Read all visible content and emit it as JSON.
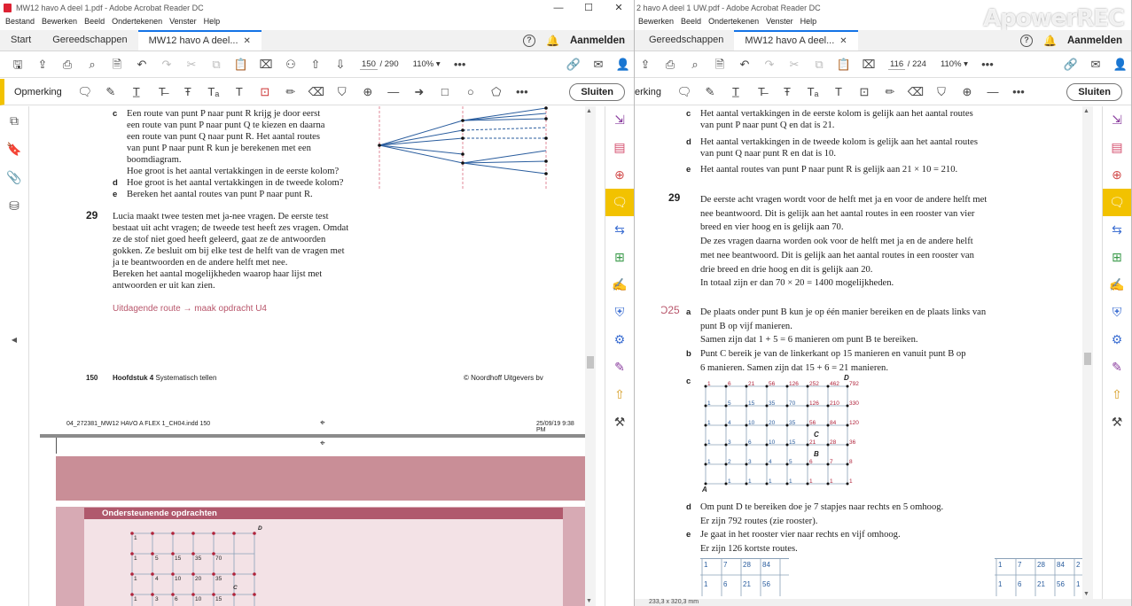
{
  "left": {
    "title": "MW12 havo A deel 1.pdf - Adobe Acrobat Reader DC",
    "menu": [
      "Bestand",
      "Bewerken",
      "Beeld",
      "Ondertekenen",
      "Venster",
      "Help"
    ],
    "tabs": {
      "start": "Start",
      "tools": "Gereedschappen",
      "doc": "MW12 havo A deel..."
    },
    "login": "Aanmelden",
    "page_current": "150",
    "page_total": "/ 290",
    "zoom": "110%",
    "comment_title": "Opmerking",
    "close_label": "Sluiten",
    "page": {
      "q_c_label": "c",
      "q_c_lines": [
        "Een route van punt P naar punt R krijg je door eerst",
        "een route van punt P naar punt Q te kiezen en daarna",
        "een route van punt Q naar punt R. Het aantal routes",
        "van punt P naar punt R kun je berekenen met een",
        "boomdiagram.",
        "Hoe groot is het aantal vertakkingen in de eerste kolom?"
      ],
      "q_d_label": "d",
      "q_d": "Hoe groot is het aantal vertakkingen in de tweede kolom?",
      "q_e_label": "e",
      "q_e": "Bereken het aantal routes van punt P naar punt R.",
      "q29_num": "29",
      "q29_lines": [
        "Lucia maakt twee testen met ja-nee vragen. De eerste test",
        "bestaat uit acht vragen; de tweede test heeft zes vragen. Omdat",
        "ze de stof niet goed heeft geleerd, gaat ze de antwoorden",
        "gokken. Ze besluit om bij elke test de helft van de vragen met",
        "ja te beantwoorden en de andere helft met nee.",
        "Bereken het aantal mogelijkheden waarop haar lijst met",
        "antwoorden er uit kan zien."
      ],
      "challenge": "Uitdagende route → maak opdracht U4",
      "footer_page": "150",
      "footer_chapter": "Hoofdstuk 4",
      "footer_chapter_title": "Systematisch tellen",
      "footer_copyright": "© Noordhoff Uitgevers bv",
      "print_slug": "04_272381_MW12 HAVO A FLEX 1_CH04.indd   150",
      "print_date": "25/09/19   9:38 PM",
      "support_header": "Ondersteunende opdrachten",
      "grid_D": "D",
      "grid_C": "C",
      "grid_rows": [
        [
          "1"
        ],
        [
          "1",
          "5",
          "15",
          "35",
          "70"
        ],
        [
          "1",
          "4",
          "10",
          "20",
          "35"
        ],
        [
          "1",
          "3",
          "6",
          "10",
          "15"
        ]
      ]
    }
  },
  "right": {
    "title": "2 havo A deel 1 UW.pdf - Adobe Acrobat Reader DC",
    "menu": [
      "Bewerken",
      "Beeld",
      "Ondertekenen",
      "Venster",
      "Help"
    ],
    "tabs": {
      "tools": "Gereedschappen",
      "doc": "MW12 havo A deel..."
    },
    "login": "Aanmelden",
    "page_current": "116",
    "page_total": "/ 224",
    "zoom": "110%",
    "comment_title": "erking",
    "close_label": "Sluiten",
    "watermark": "ApowerREC",
    "status": "233,3 x 320,3 mm",
    "page": {
      "c_label": "c",
      "c_lines": [
        "Het aantal vertakkingen in de eerste kolom is gelijk aan het aantal routes",
        "van punt P naar punt Q en dat is 21."
      ],
      "d_label": "d",
      "d_lines": [
        "Het aantal vertakkingen in de tweede kolom is gelijk aan het aantal routes",
        "van punt Q naar punt R en dat is 10."
      ],
      "e_label": "e",
      "e_line": "Het aantal routes van punt P naar punt R is gelijk aan 21 × 10 = 210.",
      "q29_num": "29",
      "q29_lines": [
        "De eerste acht vragen wordt voor de helft met ja en voor de andere helft met",
        "nee beantwoord. Dit is gelijk aan het aantal routes in een rooster van vier",
        "breed en vier hoog en is gelijk aan 70.",
        "De zes vragen daarna worden ook voor de helft met ja en de andere helft",
        "met nee beantwoord. Dit is gelijk aan het aantal routes in een rooster van",
        "drie breed en drie hoog en dit is gelijk aan 20.",
        "In totaal zijn er dan 70 × 20 = 1400 mogelijkheden."
      ],
      "o25_num": "O25",
      "o25_a_label": "a",
      "o25_a": [
        "De plaats onder punt B kun je op één manier bereiken en de plaats links van",
        "punt B op vijf manieren.",
        "Samen zijn dat 1 + 5 = 6 manieren om punt B te bereiken."
      ],
      "o25_b_label": "b",
      "o25_b": [
        "Punt C bereik je van de linkerkant op 15 manieren en vanuit punt B op",
        "6 manieren. Samen zijn dat 15 + 6 = 21 manieren."
      ],
      "o25_c_label": "c",
      "grid_D": "D",
      "grid_C": "C",
      "grid_B": "B",
      "grid_A": "A",
      "grid": [
        [
          "1",
          "6",
          "21",
          "56",
          "126",
          "252",
          "462",
          "792"
        ],
        [
          "1",
          "5",
          "15",
          "35",
          "70",
          "126",
          "210",
          "330"
        ],
        [
          "1",
          "4",
          "10",
          "20",
          "35",
          "56",
          "84",
          "120"
        ],
        [
          "1",
          "3",
          "6",
          "10",
          "15",
          "21",
          "28",
          "36"
        ],
        [
          "1",
          "2",
          "3",
          "4",
          "5",
          "6",
          "7",
          "8"
        ],
        [
          "",
          "1",
          "1",
          "1",
          "1",
          "1",
          "1",
          "1"
        ]
      ],
      "o25_d_label": "d",
      "o25_d": [
        "Om punt D te bereiken doe je 7 stapjes naar rechts en 5 omhoog.",
        "Er zijn 792 routes (zie rooster)."
      ],
      "o25_e_label": "e",
      "o25_e": [
        "Je gaat in het rooster vier naar rechts en vijf omhoog.",
        "Er zijn 126 kortste routes."
      ],
      "mini_grid_top_a": [
        "1",
        "7",
        "28",
        "84"
      ],
      "mini_grid_bot_a": [
        "1",
        "6",
        "21",
        "56"
      ],
      "mini_grid_top_b": [
        "1",
        "7",
        "28",
        "84",
        "2"
      ],
      "mini_grid_bot_b": [
        "1",
        "6",
        "21",
        "56",
        "1"
      ]
    }
  }
}
